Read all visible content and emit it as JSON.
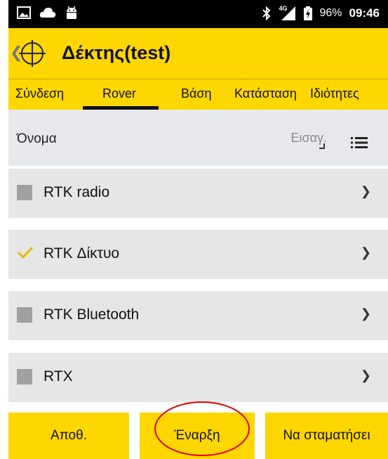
{
  "status_bar": {
    "left_icons": [
      "gallery-icon",
      "cloud-icon",
      "android-icon"
    ],
    "right_icons": [
      "bluetooth-icon",
      "signal-4g-icon",
      "battery-charging-icon"
    ],
    "network_label": "4G",
    "battery": "96%",
    "time": "09:46"
  },
  "header": {
    "title": "Δέκτης(test)",
    "icons": [
      "back-chevron-icon",
      "gnss-target-icon"
    ]
  },
  "tabs": [
    {
      "label": "Σύνδεση",
      "selected": false
    },
    {
      "label": "Rover",
      "selected": true
    },
    {
      "label": "Βάση",
      "selected": false
    },
    {
      "label": "Κατάσταση",
      "selected": false
    },
    {
      "label": "Ιδιότητες",
      "selected": false
    }
  ],
  "name_row": {
    "label": "Όνομα",
    "placeholder": "Εισαγ.",
    "value": ""
  },
  "options": [
    {
      "label": "RTK radio",
      "checked": false
    },
    {
      "label": "RTK Δίκτυο",
      "checked": true
    },
    {
      "label": "RTK Bluetooth",
      "checked": false
    },
    {
      "label": "RTX",
      "checked": false
    }
  ],
  "buttons": {
    "save": "Αποθ.",
    "start": "Έναρξη",
    "stop": "Να σταματήσει"
  },
  "colors": {
    "accent": "#ffd700",
    "row_background": "#e6e6e6",
    "highlight": "#e00000"
  }
}
